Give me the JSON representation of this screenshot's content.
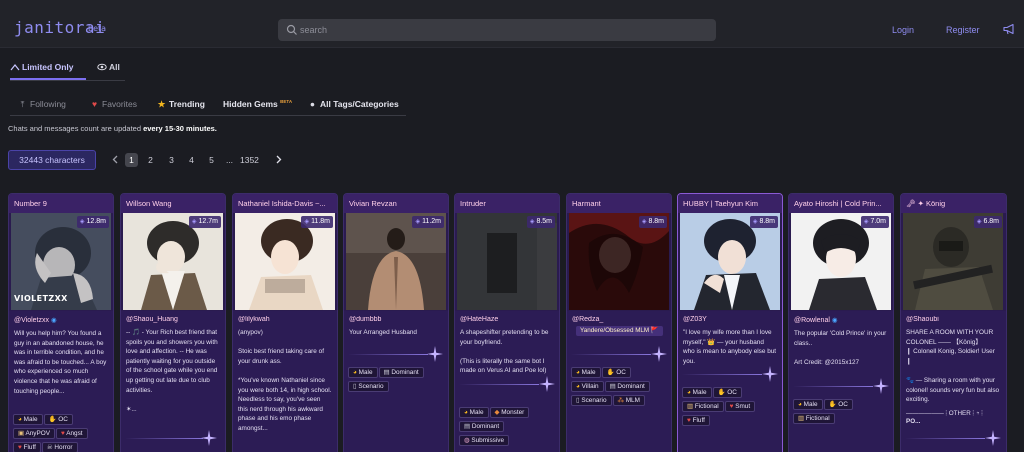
{
  "header": {
    "logo": "janitorai",
    "beta": "beta",
    "search_placeholder": "search",
    "login": "Login",
    "register": "Register"
  },
  "filter_tabs": [
    {
      "label": "Limited Only",
      "icon": "lock-icon"
    },
    {
      "label": "All",
      "icon": "eye-icon"
    }
  ],
  "categories": [
    {
      "label": "Following",
      "icon": "upload-icon"
    },
    {
      "label": "Favorites",
      "icon": "heart-icon"
    },
    {
      "label": "Trending",
      "icon": "star-icon"
    },
    {
      "label": "Hidden Gems",
      "badge": "BETA"
    },
    {
      "label": "All Tags/Categories",
      "icon": "circle-icon"
    }
  ],
  "notice": {
    "prefix": "Chats and messages count are updated ",
    "emphasis": "every 15-30 minutes."
  },
  "pagination": {
    "total": "32443 characters",
    "pages": [
      "1",
      "2",
      "3",
      "4",
      "5",
      "...",
      "1352"
    ],
    "current": "1"
  },
  "colors": {
    "accent": "#8f8cf0",
    "card_bg": "#2a1b4f",
    "card_title": "#ffd0ea"
  },
  "cards": [
    {
      "title": "Number 9",
      "count": "12.8m",
      "creator": "@Violetzxx",
      "verified": true,
      "watermark": "VIOLETZXX",
      "desc": "Will you help him? You found a guy in an abandoned house, he was in terrible condition, and he was afraid to be touched... A boy who experienced so much violence that he was afraid of touching people...",
      "tags": [
        "Male",
        "OC",
        "AnyPOV",
        "Angst",
        "Fluff",
        "Horror"
      ]
    },
    {
      "title": "Willson Wang",
      "count": "12.7m",
      "creator": "@Shaou_Huang",
      "verified": false,
      "desc": "-- 🎵 - Your Rich best friend that spoils you and showers you with love and affection. -- He was patiently waiting for you outside of the school gate while you end up getting out late due to club activities.\n\n✶...",
      "tags": []
    },
    {
      "title": "Nathaniel Ishida-Davis ~...",
      "count": "11.8m",
      "creator": "@lilykwah",
      "verified": false,
      "desc": "(anypov)\n\nStoic best friend taking care of your drunk ass.\n\n*You've known Nathaniel since you were both 14, in high school. Needless to say, you've seen this nerd through his awkward phase and his emo phase amongst...",
      "tags": []
    },
    {
      "title": "Vivian Revzan",
      "count": "11.2m",
      "creator": "@dumbbb",
      "verified": false,
      "desc": "Your Arranged Husband",
      "tags": [
        "Male",
        "Dominant",
        "Scenario"
      ]
    },
    {
      "title": "Intruder",
      "count": "8.5m",
      "creator": "@HateHaze",
      "verified": false,
      "desc": "A shapeshifter pretending to be your boyfriend.\n\n(This is literally the same bot I made on Verus AI and Poe lol)",
      "tags": [
        "Male",
        "Monster",
        "Dominant",
        "Submissive"
      ]
    },
    {
      "title": "Harmant",
      "count": "8.8m",
      "creator": "@Redza_",
      "verified": false,
      "special_tag": "Yandere/Obsessed MLM 🚩",
      "desc": "",
      "tags": [
        "Male",
        "OC",
        "Villain",
        "Dominant",
        "Scenario",
        "MLM"
      ]
    },
    {
      "title": "HUBBY | Taehyun Kim",
      "count": "8.8m",
      "creator": "@Z03Y",
      "verified": false,
      "desc": "\"I love my wife more than I love myself,\" 👑 — your husband who is mean to anybody else but you.",
      "tags": [
        "Male",
        "OC",
        "Fictional",
        "Smut",
        "Fluff"
      ]
    },
    {
      "title": "Ayato Hiroshi | Cold Prin...",
      "count": "7.0m",
      "creator": "@Rowlenal",
      "verified": true,
      "desc": "The popular 'Cold Prince' in your class..\n\nArt Credit: @2015x127",
      "tags": [
        "Male",
        "OC",
        "Fictional"
      ]
    },
    {
      "title": "🗝 ✦ König",
      "count": "6.8m",
      "creator": "@Shaoubi",
      "verified": false,
      "desc": "SHARE A ROOM WITH YOUR COLONEL —— 【König】\n❙ Colonell Konig, Soldier! User ❙\n\n🐾 — Sharing a room with your colonel! sounds very fun but also exciting.",
      "footer": "OTHER",
      "footer_sub": "PO...",
      "tags": []
    }
  ]
}
